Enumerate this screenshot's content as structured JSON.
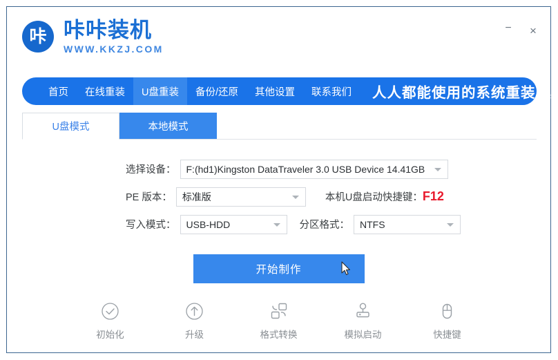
{
  "window": {
    "minimize_label": "−",
    "close_label": "×"
  },
  "brand": {
    "logo_glyph": "咔",
    "name": "咔咔装机",
    "url": "WWW.KKZJ.COM"
  },
  "nav": {
    "items": [
      {
        "label": "首页",
        "active": false
      },
      {
        "label": "在线重装",
        "active": false
      },
      {
        "label": "U盘重装",
        "active": true
      },
      {
        "label": "备份/还原",
        "active": false
      },
      {
        "label": "其他设置",
        "active": false
      },
      {
        "label": "联系我们",
        "active": false
      }
    ],
    "slogan": "人人都能使用的系统重装工具",
    "bg_color": "#1a73e8",
    "active_color": "#3788ec"
  },
  "tabs": [
    {
      "label": "U盘模式",
      "active": true
    },
    {
      "label": "本地模式",
      "active": false
    }
  ],
  "form": {
    "device": {
      "label": "选择设备：",
      "value": "F:(hd1)Kingston DataTraveler 3.0 USB Device 14.41GB"
    },
    "pe_version": {
      "label": "PE 版本：",
      "value": "标准版"
    },
    "hotkey": {
      "label": "本机U盘启动快捷键：",
      "key": "F12",
      "key_color": "#e8192c"
    },
    "write_mode": {
      "label": "写入模式：",
      "value": "USB-HDD"
    },
    "partition_format": {
      "label": "分区格式：",
      "value": "NTFS"
    }
  },
  "start_button": {
    "label": "开始制作",
    "color": "#3788ec"
  },
  "tools": [
    {
      "label": "初始化",
      "icon": "check-circle-icon"
    },
    {
      "label": "升级",
      "icon": "arrow-up-circle-icon"
    },
    {
      "label": "格式转换",
      "icon": "format-convert-icon"
    },
    {
      "label": "模拟启动",
      "icon": "joystick-icon"
    },
    {
      "label": "快捷键",
      "icon": "mouse-icon"
    }
  ]
}
